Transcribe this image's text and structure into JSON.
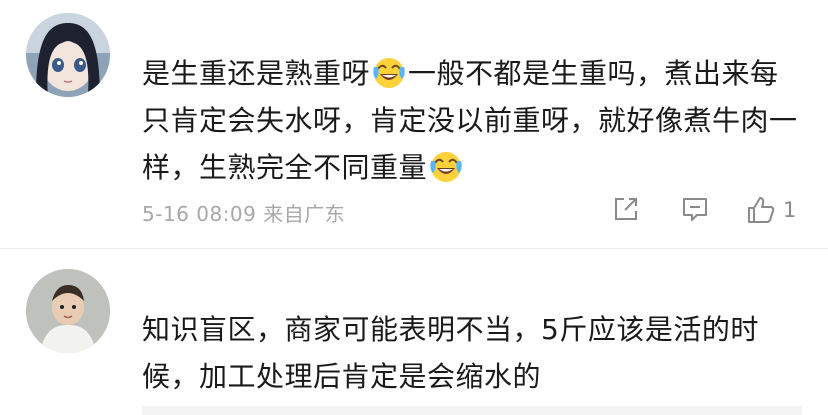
{
  "comments": [
    {
      "text_parts": [
        "是生重还是熟重呀",
        "一般不都是生重吗，煮出来每只肯定会失水呀，肯定没以前重呀，就好像煮牛肉一样，生熟完全不同重量",
        ""
      ],
      "emoji_name": "laugh-cry-emoji",
      "timestamp": "5-16 08:09",
      "location": "来自广东",
      "like_count": "1"
    },
    {
      "text": "知识盲区，商家可能表明不当，5斤应该是活的时候，加工处理后肯定是会缩水的"
    }
  ],
  "icons": {
    "share": "share-icon",
    "reply": "comment-icon",
    "like": "thumbs-up-icon"
  },
  "colors": {
    "text": "#1a1a1a",
    "meta": "#a8a8a8",
    "icon": "#8a8a8a"
  }
}
